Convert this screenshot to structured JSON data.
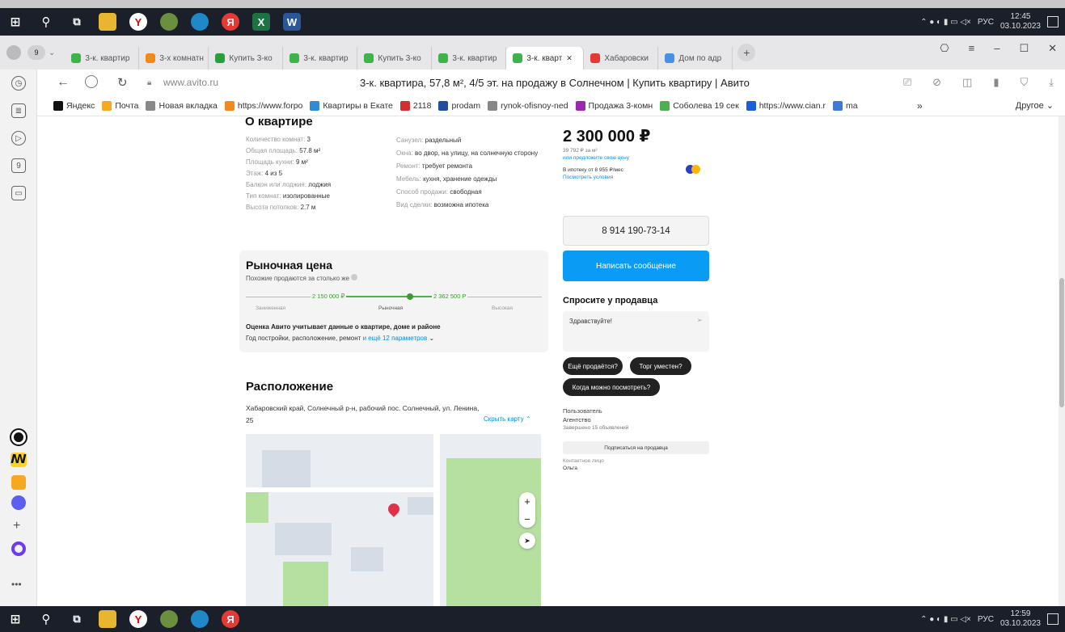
{
  "os": {
    "top_clock_time": "12:45",
    "top_clock_date": "03.10.2023",
    "bottom_clock_time": "12:59",
    "bottom_clock_date": "03.10.2023",
    "lang": "РУС"
  },
  "tabs": [
    {
      "label": "3-к. квартир",
      "color": "#3fb24c"
    },
    {
      "label": "3-х комнатн",
      "color": "#f08a1c"
    },
    {
      "label": "Купить 3-ко",
      "color": "#2a9d3e"
    },
    {
      "label": "3-к. квартир",
      "color": "#3fb24c"
    },
    {
      "label": "Купить 3-ко",
      "color": "#3fb24c"
    },
    {
      "label": "3-к. квартир",
      "color": "#3fb24c"
    },
    {
      "label": "3-к. кварт",
      "color": "#3fb24c"
    },
    {
      "label": "Хабаровски",
      "color": "#e53935"
    },
    {
      "label": "Дом по адр",
      "color": "#4a90e2"
    }
  ],
  "tab_count": "9",
  "address": {
    "domain": "www.avito.ru",
    "title": "3-к. квартира, 57,8 м², 4/5 эт. на продажу в Солнечном | Купить квартиру | Авито"
  },
  "bookmarks": [
    {
      "label": "Яндекс",
      "color": "#111"
    },
    {
      "label": "Почта",
      "color": "#f6a821"
    },
    {
      "label": "Новая вкладка",
      "color": "#888"
    },
    {
      "label": "https://www.forpo",
      "color": "#f08a1c"
    },
    {
      "label": "Квартиры в Екате",
      "color": "#2e8bd6"
    },
    {
      "label": "2118",
      "color": "#d32f2f"
    },
    {
      "label": "prodam",
      "color": "#1f4fa0"
    },
    {
      "label": "rynok-ofisnoy-ned",
      "color": "#888"
    },
    {
      "label": "Продажа 3-комн",
      "color": "#9c27b0"
    },
    {
      "label": "Соболева 19 сек",
      "color": "#4caf50"
    },
    {
      "label": "https://www.cian.r",
      "color": "#1a5fd8"
    },
    {
      "label": "ma",
      "color": "#3f7bd6"
    }
  ],
  "bookmarks_more": "»",
  "bookmarks_other": "Другое",
  "flat": {
    "heading": "О квартире",
    "left": [
      {
        "k": "Количество комнат:",
        "v": "3"
      },
      {
        "k": "Общая площадь:",
        "v": "57.8 м²"
      },
      {
        "k": "Площадь кухни:",
        "v": "9 м²"
      },
      {
        "k": "Этаж:",
        "v": "4 из 5"
      },
      {
        "k": "Балкон или лоджия:",
        "v": "лоджия"
      },
      {
        "k": "Тип комнат:",
        "v": "изолированные"
      },
      {
        "k": "Высота потолков:",
        "v": "2.7 м"
      }
    ],
    "right": [
      {
        "k": "Санузел:",
        "v": "раздельный"
      },
      {
        "k": "Окна:",
        "v": "во двор, на улицу, на солнечную сторону"
      },
      {
        "k": "Ремонт:",
        "v": "требует ремонта"
      },
      {
        "k": "Мебель:",
        "v": "кухня, хранение одежды"
      },
      {
        "k": "Способ продажи:",
        "v": "свободная"
      },
      {
        "k": "Вид сделки:",
        "v": "возможна ипотека"
      }
    ]
  },
  "market": {
    "heading": "Рыночная цена",
    "sub": "Похожие продаются за столько же",
    "low_price": "2 150 000 ₽",
    "high_price": "2 362 500 P",
    "scale_left": "Заниженная",
    "scale_mid": "Рыночная",
    "scale_right": "Высокая",
    "note_bold": "Оценка Авито учитывает данные о квартире, доме и районе",
    "note": "Год постройки, расположение, ремонт",
    "note_link": "и ещё 12 параметров"
  },
  "location": {
    "heading": "Расположение",
    "address": "Хабаровский край, Солнечный р-н, рабочий пос. Солнечный, ул. Ленина, 25",
    "hide_map": "Скрыть карту",
    "zoom_in": "+",
    "zoom_out": "−"
  },
  "price": {
    "main": "2 300 000 ₽",
    "per_m2": "39 792 ₽ за м²",
    "propose": "или предложите свою цену",
    "mortgage": "В ипотеку от 8 955 ₽/мес",
    "calc": "Посмотреть условия"
  },
  "phone": "8 914 190-73-14",
  "write_btn": "Написать сообщение",
  "ask": {
    "heading": "Спросите у продавца",
    "placeholder": "Здравствуйте!",
    "chips": [
      "Ещё продаётся?",
      "Торг уместен?",
      "Когда можно посмотреть?"
    ]
  },
  "seller": {
    "type": "Пользователь",
    "name": "Агентство",
    "stats": "Завершено 15 объявлений",
    "subscribe": "Подписаться на продавца",
    "contact_label": "Контактное лицо",
    "contact_name": "Ольга"
  }
}
